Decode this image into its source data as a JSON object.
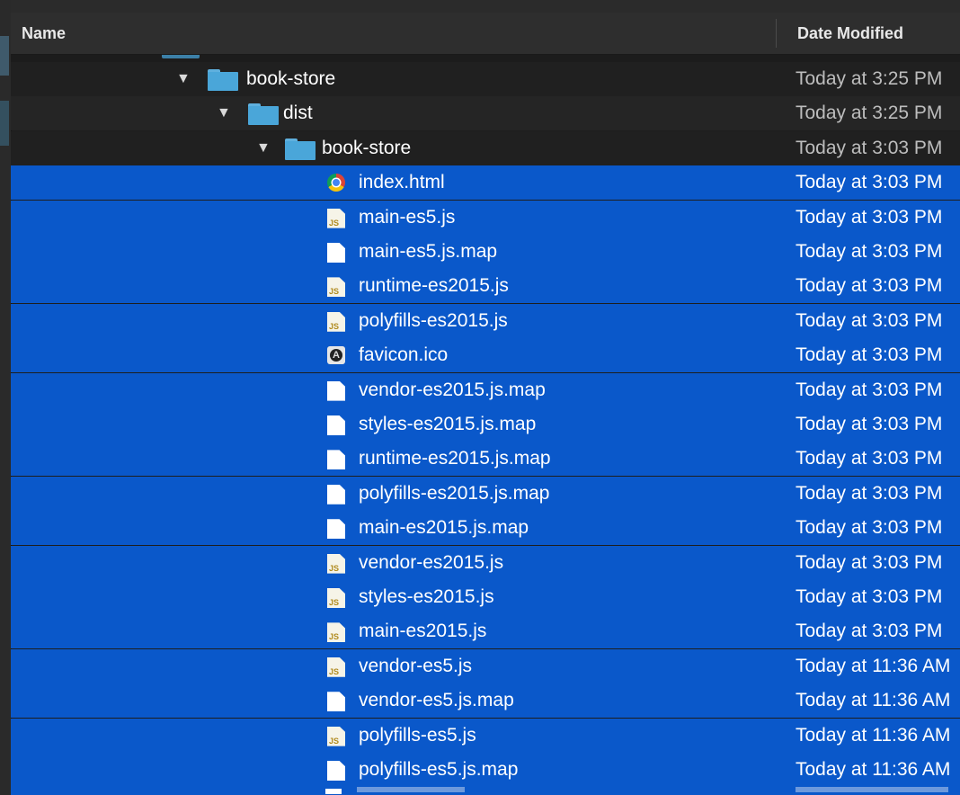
{
  "header": {
    "name_label": "Name",
    "date_label": "Date Modified"
  },
  "rows": [
    {
      "name": "book-store",
      "type": "folder",
      "date": "Today at 3:25 PM",
      "selected": false
    },
    {
      "name": "dist",
      "type": "folder",
      "date": "Today at 3:25 PM",
      "selected": false
    },
    {
      "name": "book-store",
      "type": "folder",
      "date": "Today at 3:03 PM",
      "selected": false
    },
    {
      "name": "index.html",
      "type": "chrome",
      "date": "Today at 3:03 PM",
      "selected": true
    },
    {
      "name": "main-es5.js",
      "type": "js",
      "date": "Today at 3:03 PM",
      "selected": true
    },
    {
      "name": "main-es5.js.map",
      "type": "doc",
      "date": "Today at 3:03 PM",
      "selected": true
    },
    {
      "name": "runtime-es2015.js",
      "type": "js",
      "date": "Today at 3:03 PM",
      "selected": true
    },
    {
      "name": "polyfills-es2015.js",
      "type": "js",
      "date": "Today at 3:03 PM",
      "selected": true
    },
    {
      "name": "favicon.ico",
      "type": "angular",
      "date": "Today at 3:03 PM",
      "selected": true
    },
    {
      "name": "vendor-es2015.js.map",
      "type": "doc",
      "date": "Today at 3:03 PM",
      "selected": true
    },
    {
      "name": "styles-es2015.js.map",
      "type": "doc",
      "date": "Today at 3:03 PM",
      "selected": true
    },
    {
      "name": "runtime-es2015.js.map",
      "type": "doc",
      "date": "Today at 3:03 PM",
      "selected": true
    },
    {
      "name": "polyfills-es2015.js.map",
      "type": "doc",
      "date": "Today at 3:03 PM",
      "selected": true
    },
    {
      "name": "main-es2015.js.map",
      "type": "doc",
      "date": "Today at 3:03 PM",
      "selected": true
    },
    {
      "name": "vendor-es2015.js",
      "type": "js",
      "date": "Today at 3:03 PM",
      "selected": true
    },
    {
      "name": "styles-es2015.js",
      "type": "js",
      "date": "Today at 3:03 PM",
      "selected": true
    },
    {
      "name": "main-es2015.js",
      "type": "js",
      "date": "Today at 3:03 PM",
      "selected": true
    },
    {
      "name": "vendor-es5.js",
      "type": "js",
      "date": "Today at 11:36 AM",
      "selected": true
    },
    {
      "name": "vendor-es5.js.map",
      "type": "doc",
      "date": "Today at 11:36 AM",
      "selected": true
    },
    {
      "name": "polyfills-es5.js",
      "type": "js",
      "date": "Today at 11:36 AM",
      "selected": true
    },
    {
      "name": "polyfills-es5.js.map",
      "type": "doc",
      "date": "Today at 11:36 AM",
      "selected": true
    }
  ],
  "js_badge": "JS",
  "colors": {
    "selection": "#0a58ca",
    "folder": "#4aa6d9",
    "background": "#1e1e1e"
  }
}
